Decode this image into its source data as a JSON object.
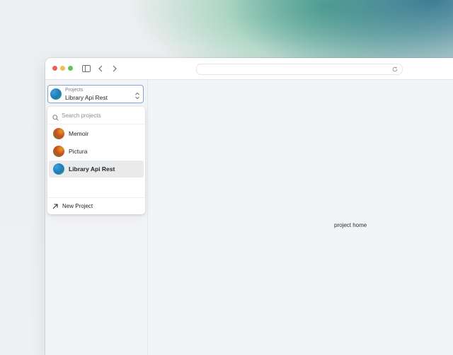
{
  "browser": {
    "traffic_lights": {
      "red": "#ee5f57",
      "yellow": "#f5bd4f",
      "green": "#5ec553"
    },
    "icons": [
      "sidebar-toggle-icon",
      "chevron-left-icon",
      "chevron-right-icon",
      "reload-icon"
    ]
  },
  "switcher": {
    "caption": "Projects",
    "value": "Library Api Rest"
  },
  "search": {
    "placeholder": "Search projects"
  },
  "projects": [
    {
      "label": "Memoir",
      "avatar": "red-green-gradient"
    },
    {
      "label": "Pictura",
      "avatar": "red-green-gradient"
    },
    {
      "label": "Library Api Rest",
      "avatar": "blue-green-gradient",
      "selected": true
    }
  ],
  "new_project": {
    "label": "New Project",
    "icon": "arrow-up-right-icon"
  },
  "main": {
    "text": "project home"
  },
  "colors": {
    "focus_border": "#7aa6d8",
    "selected_row": "#e9eaec",
    "window_bg": "#f3f4f6"
  }
}
